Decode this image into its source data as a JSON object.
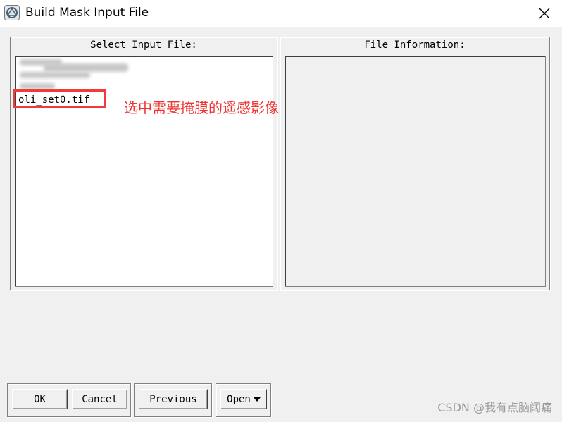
{
  "window": {
    "title": "Build Mask Input File",
    "app_icon": "envi-app-icon",
    "close_icon": "close-icon"
  },
  "left_panel": {
    "title": "Select Input File:",
    "files": [
      "oli_set0.tif"
    ],
    "selected_file": "oli_set0.tif"
  },
  "right_panel": {
    "title": "File Information:"
  },
  "annotation": {
    "text": "选中需要掩膜的遥感影像",
    "color": "#ef3434"
  },
  "buttons": {
    "ok": "OK",
    "cancel": "Cancel",
    "previous": "Previous",
    "open": "Open",
    "open_dropdown_icon": "dropdown-arrow-icon"
  },
  "watermark": "CSDN @我有点脑阔痛",
  "colors": {
    "highlight": "#f23a3a",
    "window_bg": "#f0f0f0"
  }
}
